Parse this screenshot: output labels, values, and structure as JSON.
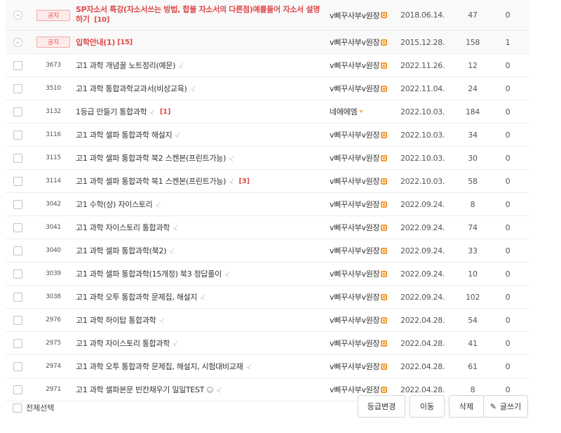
{
  "notices": [
    {
      "badge": "공지",
      "title": "SP자소서 특강(자소서쓰는 방법, 합불 자소서의 다른점)예를들어 자소서 설명하기",
      "comments": "[10]",
      "author": "v삐꾸사부v원장",
      "date": "2018.06.14.",
      "views": "47",
      "likes": "0"
    },
    {
      "badge": "공지",
      "title": "입학안내(1)",
      "comments": "[15]",
      "author": "v삐꾸사부v원장",
      "date": "2015.12.28.",
      "views": "158",
      "likes": "1"
    }
  ],
  "posts": [
    {
      "num": "3673",
      "title": "고1 과학 개념꿀 노트정리(예문)",
      "comments": "",
      "author": "v삐꾸사부v원장",
      "date": "2022.11.26.",
      "views": "12",
      "likes": "0"
    },
    {
      "num": "3510",
      "title": "고1 과학 통합과학교과서(비상교육)",
      "comments": "",
      "author": "v삐꾸사부v원장",
      "date": "2022.11.04.",
      "views": "24",
      "likes": "0"
    },
    {
      "num": "3132",
      "title": "1등급 만들기 통합과학",
      "comments": "[1]",
      "author": "네에에엠",
      "date": "2022.10.03.",
      "views": "184",
      "likes": "0"
    },
    {
      "num": "3116",
      "title": "고1 과학 셀파 통합과학 해설지",
      "comments": "",
      "author": "v삐꾸사부v원장",
      "date": "2022.10.03.",
      "views": "34",
      "likes": "0"
    },
    {
      "num": "3115",
      "title": "고1 과학 셀파 통합과학 북2 스켄본(프린트가능)",
      "comments": "",
      "author": "v삐꾸사부v원장",
      "date": "2022.10.03.",
      "views": "30",
      "likes": "0"
    },
    {
      "num": "3114",
      "title": "고1 과학 셀파 통합과학 북1 스켄본(프린트가능)",
      "comments": "[3]",
      "author": "v삐꾸사부v원장",
      "date": "2022.10.03.",
      "views": "58",
      "likes": "0"
    },
    {
      "num": "3042",
      "title": "고1 수학(상) 자이스토리",
      "comments": "",
      "author": "v삐꾸사부v원장",
      "date": "2022.09.24.",
      "views": "8",
      "likes": "0"
    },
    {
      "num": "3041",
      "title": "고1 과학 자이스토리 통합과학",
      "comments": "",
      "author": "v삐꾸사부v원장",
      "date": "2022.09.24.",
      "views": "74",
      "likes": "0"
    },
    {
      "num": "3040",
      "title": "고1 과학 셀파 통합과학(북2)",
      "comments": "",
      "author": "v삐꾸사부v원장",
      "date": "2022.09.24.",
      "views": "33",
      "likes": "0"
    },
    {
      "num": "3039",
      "title": "고1 과학 셀파 통합과학(15개정) 북3 정답풀이",
      "comments": "",
      "author": "v삐꾸사부v원장",
      "date": "2022.09.24.",
      "views": "10",
      "likes": "0"
    },
    {
      "num": "3038",
      "title": "고1 과학 오투 통합과학 문제집, 해설지",
      "comments": "",
      "author": "v삐꾸사부v원장",
      "date": "2022.09.24.",
      "views": "102",
      "likes": "0"
    },
    {
      "num": "2976",
      "title": "고1 과학 하이탑 통합과학",
      "comments": "",
      "author": "v삐꾸사부v원장",
      "date": "2022.04.28.",
      "views": "54",
      "likes": "0"
    },
    {
      "num": "2975",
      "title": "고1 과학 자이스토리 통합과학",
      "comments": "",
      "author": "v삐꾸사부v원장",
      "date": "2022.04.28.",
      "views": "41",
      "likes": "0"
    },
    {
      "num": "2974",
      "title": "고1 과학 오투 통합과학 문제집, 해설지, 시험대비교재",
      "comments": "",
      "author": "v삐꾸사부v원장",
      "date": "2022.04.28.",
      "views": "61",
      "likes": "0"
    },
    {
      "num": "2971",
      "title": "고1 과학 셀파본문 빈칸채우기 일일TEST",
      "comments": "",
      "author": "v삐꾸사부v원장",
      "date": "2022.04.28.",
      "views": "8",
      "likes": "0"
    }
  ],
  "footer": {
    "select_all": "전체선택",
    "grade_change": "등급변경",
    "move": "이동",
    "delete": "삭제",
    "write": "글쓰기"
  },
  "icons": {
    "attachment": "paperclip-icon",
    "grade": "staff-grade-icon",
    "emoticon": "emoticon-icon",
    "write": "pencil-icon"
  },
  "colors": {
    "notice_title": "#e04848",
    "notice_badge_bg": "#fdeaea",
    "grade_icon": "#f29a2e"
  }
}
